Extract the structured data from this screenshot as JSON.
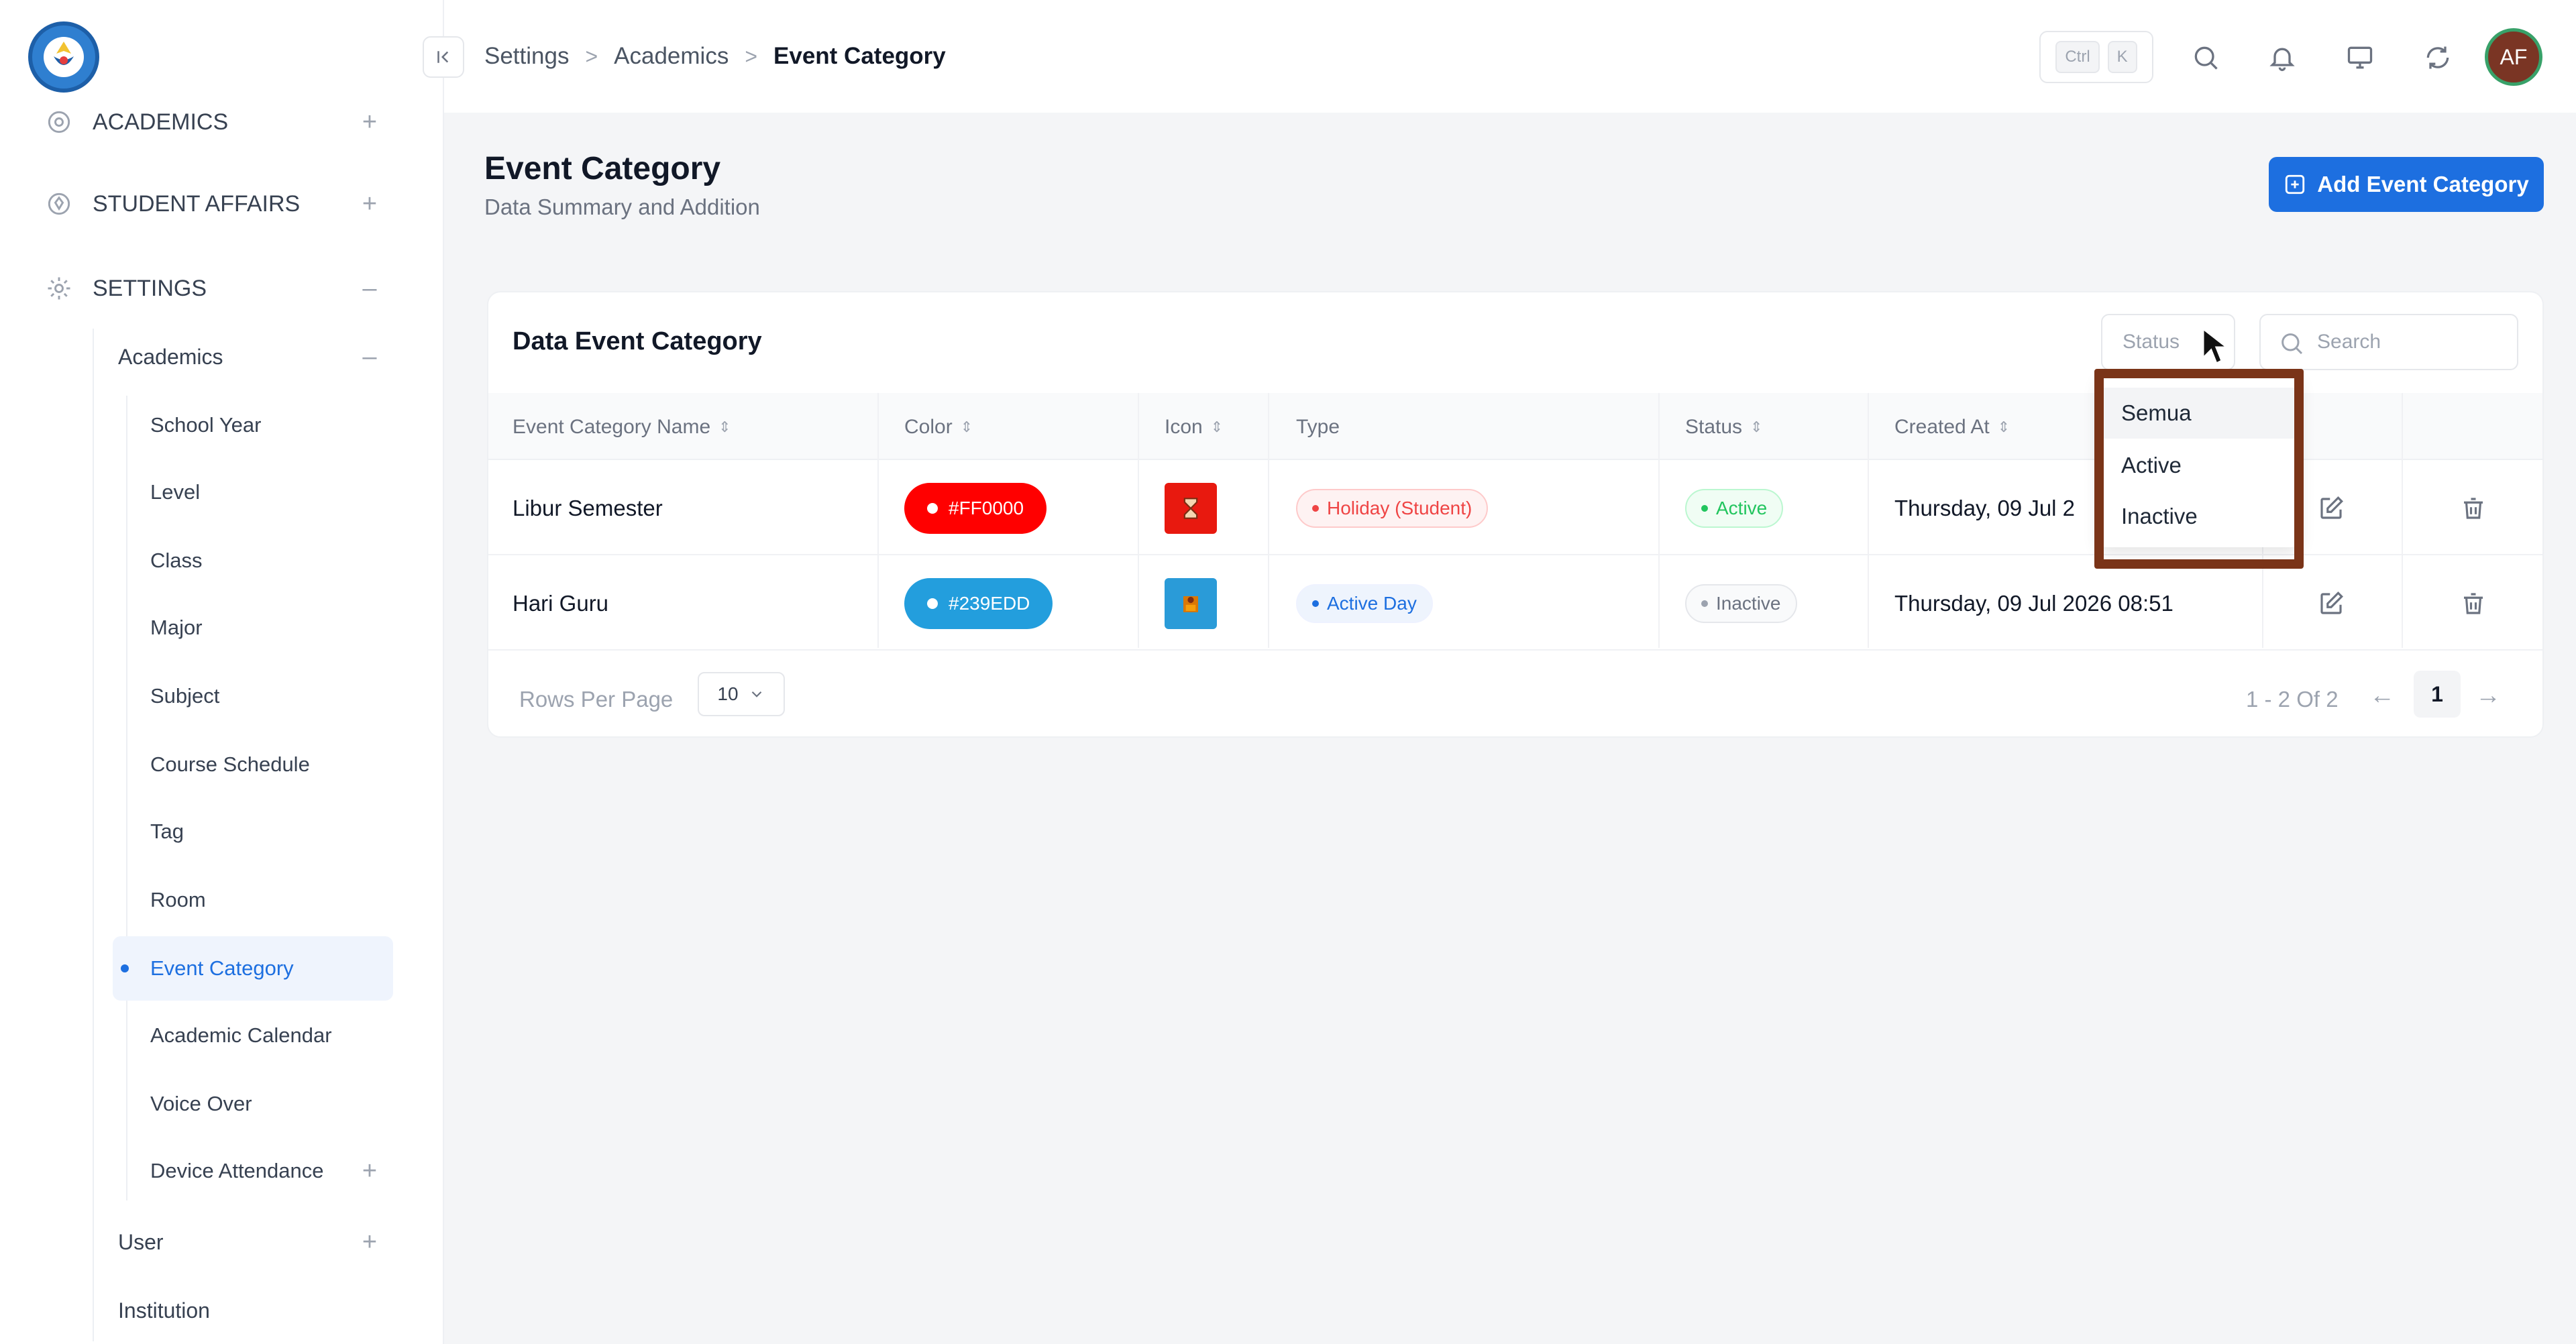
{
  "sidebar": {
    "items": [
      {
        "label": "ACADEMICS",
        "toggle": "+"
      },
      {
        "label": "STUDENT AFFAIRS",
        "toggle": "+"
      },
      {
        "label": "SETTINGS",
        "toggle": "–"
      }
    ],
    "academics": {
      "label": "Academics",
      "toggle": "–"
    },
    "sub_items": [
      "School Year",
      "Level",
      "Class",
      "Major",
      "Subject",
      "Course Schedule",
      "Tag",
      "Room",
      "Event Category",
      "Academic Calendar",
      "Voice Over"
    ],
    "device_attendance": {
      "label": "Device Attendance",
      "toggle": "+"
    },
    "user": {
      "label": "User",
      "toggle": "+"
    },
    "institution": {
      "label": "Institution"
    }
  },
  "topbar": {
    "breadcrumb": [
      "Settings",
      "Academics",
      "Event Category"
    ],
    "separator": ">",
    "shortcut": [
      "Ctrl",
      "K"
    ],
    "avatar_initials": "AF"
  },
  "page": {
    "title": "Event Category",
    "subtitle": "Data Summary and Addition",
    "add_button": "Add Event Category"
  },
  "card": {
    "title": "Data Event Category",
    "status_filter": "Status",
    "search_placeholder": "Search"
  },
  "table": {
    "headers": [
      "Event Category Name",
      "Color",
      "Icon",
      "Type",
      "Status",
      "Created At"
    ],
    "sort_glyph": "⇕",
    "rows": [
      {
        "name": "Libur Semester",
        "color": "#FF0000",
        "icon_bg": "#e8190f",
        "type": "Holiday (Student)",
        "status": "Active",
        "created_at": "Thursday, 09 Jul 2"
      },
      {
        "name": "Hari Guru",
        "color": "#239EDD",
        "icon_bg": "#2a9bd8",
        "type": "Active Day",
        "status": "Inactive",
        "created_at": "Thursday, 09 Jul 2026 08:51"
      }
    ]
  },
  "pagination": {
    "rows_per_page_label": "Rows Per Page",
    "rows_per_page": "10",
    "range": "1 - 2 Of 2",
    "current_page": "1",
    "prev": "←",
    "next": "→"
  },
  "status_dropdown": {
    "options": [
      "Semua",
      "Active",
      "Inactive"
    ],
    "selected": "Semua"
  },
  "colors": {
    "accent": "#1d6fe0",
    "highlight_frame": "#7a3418",
    "active_badge": "#22c55e",
    "holiday_badge": "#ef4444"
  }
}
